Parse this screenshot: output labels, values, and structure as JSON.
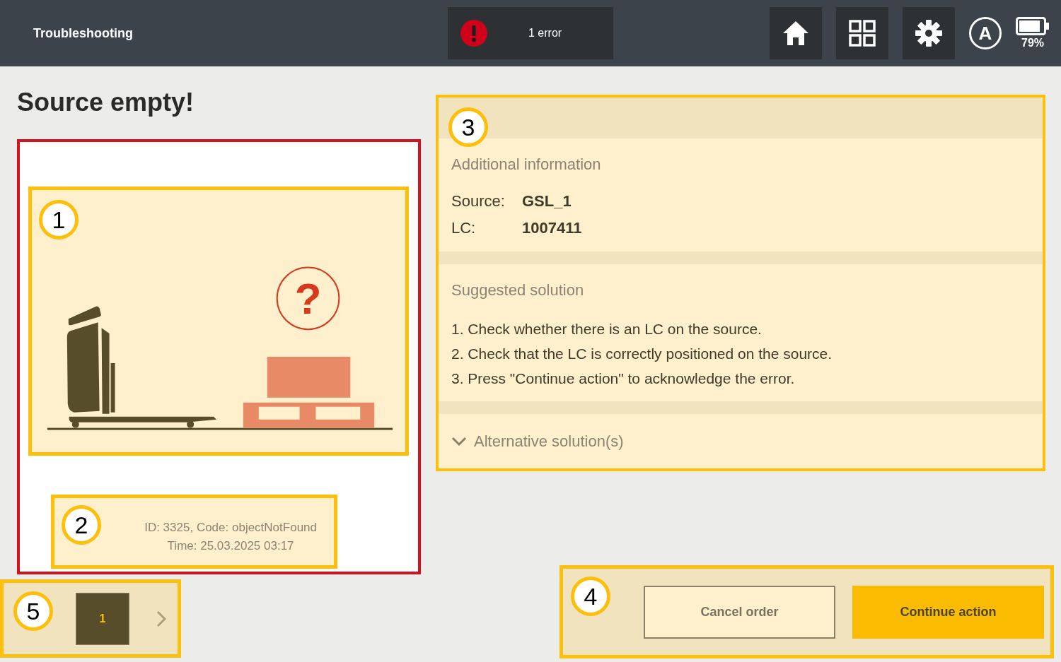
{
  "header": {
    "title": "Troubleshooting",
    "error_count": "1 error",
    "mode_badge": "A",
    "battery": "79%"
  },
  "page_title": "Source empty!",
  "illustration": {
    "callout": "1",
    "question_mark": "?"
  },
  "error_meta": {
    "callout": "2",
    "lines": [
      "ID: 3325, Code: objectNotFound",
      "Time: 25.03.2025 03:17"
    ]
  },
  "pagination": {
    "callout": "5",
    "pages": [
      {
        "label": "1",
        "selected": true
      }
    ]
  },
  "info_panel": {
    "callout": "3",
    "additional_title": "Additional information",
    "details": [
      {
        "label": "Source:",
        "value": "GSL_1"
      },
      {
        "label": "LC:",
        "value": "1007411"
      }
    ],
    "solution_title": "Suggested solution",
    "steps": [
      "1. Check whether there is an LC on the source.",
      "2. Check that the LC is correctly positioned on the source.",
      "3. Press \"Continue action\" to acknowledge the error."
    ],
    "alternative": {
      "label": "Alternative solution(s)",
      "expanded": false
    }
  },
  "actions": {
    "callout": "4",
    "buttons": [
      {
        "label": "Cancel order",
        "kind": "secondary"
      },
      {
        "label": "Continue action",
        "kind": "primary"
      }
    ]
  }
}
